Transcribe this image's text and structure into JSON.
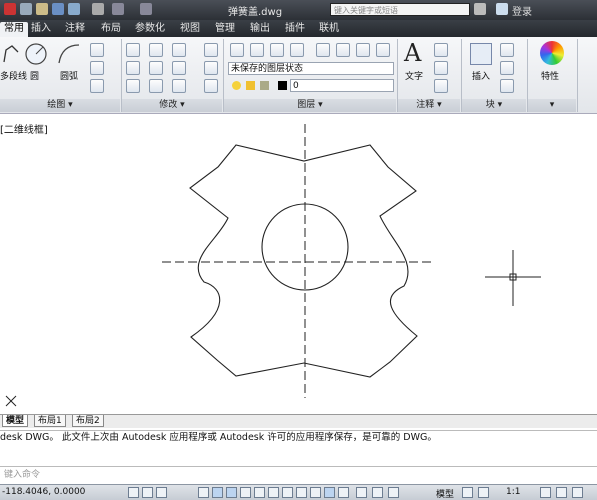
{
  "window": {
    "title": "弹簧盖.dwg",
    "search_placeholder": "键入关键字或短语",
    "login_label": "登录"
  },
  "tabs": [
    "常用",
    "插入",
    "注释",
    "布局",
    "参数化",
    "视图",
    "管理",
    "输出",
    "插件",
    "联机"
  ],
  "ribbon": {
    "draw": {
      "line_label": "多段线",
      "circle_label": "圆",
      "arc_label": "圆弧",
      "panel_label": "绘图 ▾"
    },
    "modify": {
      "panel_label": "修改 ▾"
    },
    "layers": {
      "layer_state": "未保存的图层状态",
      "current_layer": "0",
      "panel_label": "图层 ▾"
    },
    "annotation": {
      "text_label": "文字",
      "panel_label": "注释 ▾"
    },
    "block": {
      "insert_label": "插入",
      "panel_label": "块 ▾"
    },
    "properties": {
      "properties_label": "特性",
      "panel_label": "▾"
    }
  },
  "viewport": {
    "label": "[二维线框]"
  },
  "layout_tabs": {
    "model": "模型",
    "layout1": "布局1",
    "layout2": "布局2"
  },
  "command": {
    "history": "desk DWG。  此文件上次由 Autodesk 应用程序或 Autodesk 许可的应用程序保存，是可靠的 DWG。",
    "input_placeholder": "键入命令"
  },
  "status": {
    "coordinates": "-118.4046, 0.0000",
    "model_label": "模型",
    "scale_label": "1:1"
  },
  "colors": {
    "titlebar": "#2c3036",
    "ribbon": "#e9ecf0",
    "canvas_bg": "#ffffff",
    "geometry": "#222222"
  }
}
